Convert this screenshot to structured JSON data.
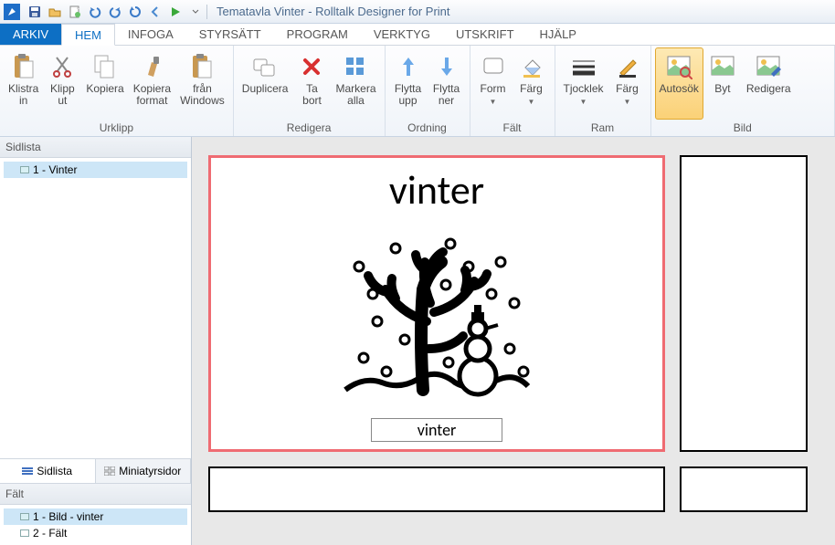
{
  "app": {
    "title": "Tematavla Vinter - Rolltalk Designer for Print"
  },
  "menu": {
    "file": "ARKIV",
    "tabs": [
      "HEM",
      "INFOGA",
      "STYRSÄTT",
      "PROGRAM",
      "VERKTYG",
      "UTSKRIFT",
      "HJÄLP"
    ],
    "active_index": 0
  },
  "ribbon": {
    "groups": [
      {
        "label": "Urklipp",
        "items": [
          {
            "label1": "Klistra",
            "label2": "in",
            "icon": "paste"
          },
          {
            "label1": "Klipp",
            "label2": "ut",
            "icon": "cut"
          },
          {
            "label1": "Kopiera",
            "label2": "",
            "icon": "copy"
          },
          {
            "label1": "Kopiera",
            "label2": "format",
            "icon": "paintbrush"
          },
          {
            "label1": "från",
            "label2": "Windows",
            "icon": "paste-win"
          }
        ]
      },
      {
        "label": "Redigera",
        "items": [
          {
            "label1": "Duplicera",
            "label2": "",
            "icon": "duplicate"
          },
          {
            "label1": "Ta",
            "label2": "bort",
            "icon": "delete"
          },
          {
            "label1": "Markera",
            "label2": "alla",
            "icon": "select-all"
          }
        ]
      },
      {
        "label": "Ordning",
        "items": [
          {
            "label1": "Flytta",
            "label2": "upp",
            "icon": "arrow-up"
          },
          {
            "label1": "Flytta",
            "label2": "ner",
            "icon": "arrow-down"
          }
        ]
      },
      {
        "label": "Fält",
        "items": [
          {
            "label1": "Form",
            "label2": "▾",
            "icon": "shape"
          },
          {
            "label1": "Färg",
            "label2": "▾",
            "icon": "fill"
          }
        ]
      },
      {
        "label": "Ram",
        "items": [
          {
            "label1": "Tjocklek",
            "label2": "▾",
            "icon": "thickness"
          },
          {
            "label1": "Färg",
            "label2": "▾",
            "icon": "border-color"
          }
        ]
      },
      {
        "label": "Bild",
        "items": [
          {
            "label1": "Autosök",
            "label2": "",
            "icon": "autosearch",
            "selected": true
          },
          {
            "label1": "Byt",
            "label2": "",
            "icon": "swap"
          },
          {
            "label1": "Redigera",
            "label2": "",
            "icon": "edit"
          }
        ]
      }
    ]
  },
  "sidebar": {
    "sidlista_header": "Sidlista",
    "tree_items": [
      {
        "label": "1 - Vinter",
        "selected": true
      }
    ],
    "tabs": {
      "sidlista": "Sidlista",
      "miniatyrsidor": "Miniatyrsidor",
      "active": "sidlista"
    },
    "felt_header": "Fält",
    "felt_items": [
      {
        "label": "1 - Bild - vinter",
        "selected": true
      },
      {
        "label": "2 - Fält"
      }
    ]
  },
  "canvas": {
    "main_card": {
      "title": "vinter",
      "caption": "vinter"
    }
  }
}
